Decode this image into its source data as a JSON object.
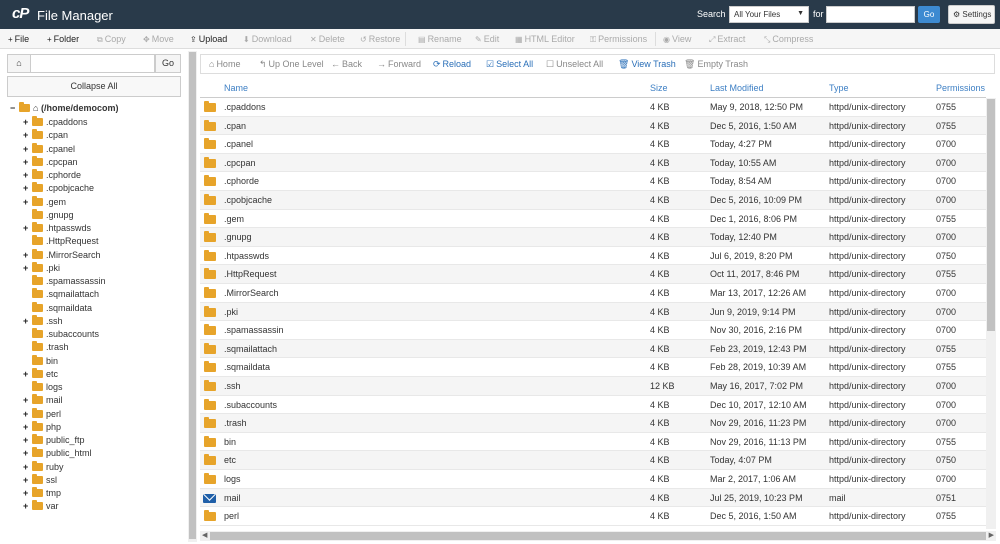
{
  "header": {
    "logo": "cP",
    "title": "File Manager",
    "search_label": "Search",
    "search_scope": "All Your Files",
    "for_label": "for",
    "search_value": "",
    "go_label": "Go",
    "settings_label": "Settings"
  },
  "toolbar": {
    "items": [
      {
        "name": "file",
        "label": "File",
        "icon": "+",
        "enabled": true
      },
      {
        "name": "folder",
        "label": "Folder",
        "icon": "+",
        "enabled": true
      },
      {
        "name": "copy",
        "label": "Copy",
        "icon": "⧉",
        "enabled": false
      },
      {
        "name": "move",
        "label": "Move",
        "icon": "✥",
        "enabled": false
      },
      {
        "name": "upload",
        "label": "Upload",
        "icon": "⇪",
        "enabled": true
      },
      {
        "name": "download",
        "label": "Download",
        "icon": "⬇",
        "enabled": false
      },
      {
        "name": "delete",
        "label": "Delete",
        "icon": "✕",
        "enabled": false
      },
      {
        "name": "restore",
        "label": "Restore",
        "icon": "↺",
        "enabled": false
      },
      {
        "name": "rename",
        "label": "Rename",
        "icon": "▤",
        "enabled": false
      },
      {
        "name": "edit",
        "label": "Edit",
        "icon": "✎",
        "enabled": false
      },
      {
        "name": "html-editor",
        "label": "HTML Editor",
        "icon": "▦",
        "enabled": false
      },
      {
        "name": "permissions",
        "label": "Permissions",
        "icon": "⚿",
        "enabled": false
      },
      {
        "name": "view",
        "label": "View",
        "icon": "◉",
        "enabled": false
      },
      {
        "name": "extract",
        "label": "Extract",
        "icon": "⤢",
        "enabled": false
      },
      {
        "name": "compress",
        "label": "Compress",
        "icon": "⤡",
        "enabled": false
      }
    ]
  },
  "left": {
    "path_value": "",
    "go_label": "Go",
    "collapse_label": "Collapse All",
    "root_label": "(/home/democom)",
    "tree": [
      {
        "label": ".cpaddons",
        "expandable": true
      },
      {
        "label": ".cpan",
        "expandable": true
      },
      {
        "label": ".cpanel",
        "expandable": true
      },
      {
        "label": ".cpcpan",
        "expandable": true
      },
      {
        "label": ".cphorde",
        "expandable": true
      },
      {
        "label": ".cpobjcache",
        "expandable": true
      },
      {
        "label": ".gem",
        "expandable": true
      },
      {
        "label": ".gnupg",
        "expandable": false
      },
      {
        "label": ".htpasswds",
        "expandable": true
      },
      {
        "label": ".HttpRequest",
        "expandable": false
      },
      {
        "label": ".MirrorSearch",
        "expandable": true
      },
      {
        "label": ".pki",
        "expandable": true
      },
      {
        "label": ".spamassassin",
        "expandable": false
      },
      {
        "label": ".sqmailattach",
        "expandable": false
      },
      {
        "label": ".sqmaildata",
        "expandable": false
      },
      {
        "label": ".ssh",
        "expandable": true
      },
      {
        "label": ".subaccounts",
        "expandable": false
      },
      {
        "label": ".trash",
        "expandable": false
      },
      {
        "label": "bin",
        "expandable": false
      },
      {
        "label": "etc",
        "expandable": true
      },
      {
        "label": "logs",
        "expandable": false
      },
      {
        "label": "mail",
        "expandable": true
      },
      {
        "label": "perl",
        "expandable": true
      },
      {
        "label": "php",
        "expandable": true
      },
      {
        "label": "public_ftp",
        "expandable": true
      },
      {
        "label": "public_html",
        "expandable": true
      },
      {
        "label": "ruby",
        "expandable": true
      },
      {
        "label": "ssl",
        "expandable": true
      },
      {
        "label": "tmp",
        "expandable": true
      },
      {
        "label": "var",
        "expandable": true
      }
    ]
  },
  "nav": {
    "items": [
      {
        "name": "home",
        "label": "Home",
        "icon": "⌂",
        "active": false
      },
      {
        "name": "up-one-level",
        "label": "Up One Level",
        "icon": "↰",
        "active": false
      },
      {
        "name": "back",
        "label": "Back",
        "icon": "←",
        "active": false
      },
      {
        "name": "forward",
        "label": "Forward",
        "icon": "→",
        "active": false
      },
      {
        "name": "reload",
        "label": "Reload",
        "icon": "⟳",
        "active": true
      },
      {
        "name": "select-all",
        "label": "Select All",
        "icon": "☑",
        "active": true
      },
      {
        "name": "unselect-all",
        "label": "Unselect All",
        "icon": "☐",
        "active": false
      },
      {
        "name": "view-trash",
        "label": "View Trash",
        "icon": "🗑",
        "active": true
      },
      {
        "name": "empty-trash",
        "label": "Empty Trash",
        "icon": "🗑",
        "active": false
      }
    ]
  },
  "table": {
    "columns": {
      "name": "Name",
      "size": "Size",
      "modified": "Last Modified",
      "type": "Type",
      "perms": "Permissions"
    },
    "rows": [
      {
        "name": ".cpaddons",
        "size": "4 KB",
        "modified": "May 9, 2018, 12:50 PM",
        "type": "httpd/unix-directory",
        "perms": "0755",
        "icon": "folder"
      },
      {
        "name": ".cpan",
        "size": "4 KB",
        "modified": "Dec 5, 2016, 1:50 AM",
        "type": "httpd/unix-directory",
        "perms": "0755",
        "icon": "folder"
      },
      {
        "name": ".cpanel",
        "size": "4 KB",
        "modified": "Today, 4:27 PM",
        "type": "httpd/unix-directory",
        "perms": "0700",
        "icon": "folder"
      },
      {
        "name": ".cpcpan",
        "size": "4 KB",
        "modified": "Today, 10:55 AM",
        "type": "httpd/unix-directory",
        "perms": "0700",
        "icon": "folder"
      },
      {
        "name": ".cphorde",
        "size": "4 KB",
        "modified": "Today, 8:54 AM",
        "type": "httpd/unix-directory",
        "perms": "0700",
        "icon": "folder"
      },
      {
        "name": ".cpobjcache",
        "size": "4 KB",
        "modified": "Dec 5, 2016, 10:09 PM",
        "type": "httpd/unix-directory",
        "perms": "0700",
        "icon": "folder"
      },
      {
        "name": ".gem",
        "size": "4 KB",
        "modified": "Dec 1, 2016, 8:06 PM",
        "type": "httpd/unix-directory",
        "perms": "0755",
        "icon": "folder"
      },
      {
        "name": ".gnupg",
        "size": "4 KB",
        "modified": "Today, 12:40 PM",
        "type": "httpd/unix-directory",
        "perms": "0700",
        "icon": "folder"
      },
      {
        "name": ".htpasswds",
        "size": "4 KB",
        "modified": "Jul 6, 2019, 8:20 PM",
        "type": "httpd/unix-directory",
        "perms": "0750",
        "icon": "folder"
      },
      {
        "name": ".HttpRequest",
        "size": "4 KB",
        "modified": "Oct 11, 2017, 8:46 PM",
        "type": "httpd/unix-directory",
        "perms": "0755",
        "icon": "folder"
      },
      {
        "name": ".MirrorSearch",
        "size": "4 KB",
        "modified": "Mar 13, 2017, 12:26 AM",
        "type": "httpd/unix-directory",
        "perms": "0700",
        "icon": "folder"
      },
      {
        "name": ".pki",
        "size": "4 KB",
        "modified": "Jun 9, 2019, 9:14 PM",
        "type": "httpd/unix-directory",
        "perms": "0700",
        "icon": "folder"
      },
      {
        "name": ".spamassassin",
        "size": "4 KB",
        "modified": "Nov 30, 2016, 2:16 PM",
        "type": "httpd/unix-directory",
        "perms": "0700",
        "icon": "folder"
      },
      {
        "name": ".sqmailattach",
        "size": "4 KB",
        "modified": "Feb 23, 2019, 12:43 PM",
        "type": "httpd/unix-directory",
        "perms": "0755",
        "icon": "folder"
      },
      {
        "name": ".sqmaildata",
        "size": "4 KB",
        "modified": "Feb 28, 2019, 10:39 AM",
        "type": "httpd/unix-directory",
        "perms": "0755",
        "icon": "folder"
      },
      {
        "name": ".ssh",
        "size": "12 KB",
        "modified": "May 16, 2017, 7:02 PM",
        "type": "httpd/unix-directory",
        "perms": "0700",
        "icon": "folder"
      },
      {
        "name": ".subaccounts",
        "size": "4 KB",
        "modified": "Dec 10, 2017, 12:10 AM",
        "type": "httpd/unix-directory",
        "perms": "0700",
        "icon": "folder"
      },
      {
        "name": ".trash",
        "size": "4 KB",
        "modified": "Nov 29, 2016, 11:23 PM",
        "type": "httpd/unix-directory",
        "perms": "0700",
        "icon": "folder"
      },
      {
        "name": "bin",
        "size": "4 KB",
        "modified": "Nov 29, 2016, 11:13 PM",
        "type": "httpd/unix-directory",
        "perms": "0755",
        "icon": "folder"
      },
      {
        "name": "etc",
        "size": "4 KB",
        "modified": "Today, 4:07 PM",
        "type": "httpd/unix-directory",
        "perms": "0750",
        "icon": "folder"
      },
      {
        "name": "logs",
        "size": "4 KB",
        "modified": "Mar 2, 2017, 1:06 AM",
        "type": "httpd/unix-directory",
        "perms": "0700",
        "icon": "folder"
      },
      {
        "name": "mail",
        "size": "4 KB",
        "modified": "Jul 25, 2019, 10:23 PM",
        "type": "mail",
        "perms": "0751",
        "icon": "mail"
      },
      {
        "name": "perl",
        "size": "4 KB",
        "modified": "Dec 5, 2016, 1:50 AM",
        "type": "httpd/unix-directory",
        "perms": "0755",
        "icon": "folder"
      }
    ]
  },
  "colors": {
    "header_bg": "#293a4a",
    "accent": "#3d8ad1",
    "folder": "#e7a42a",
    "link": "#2a6fb8"
  }
}
